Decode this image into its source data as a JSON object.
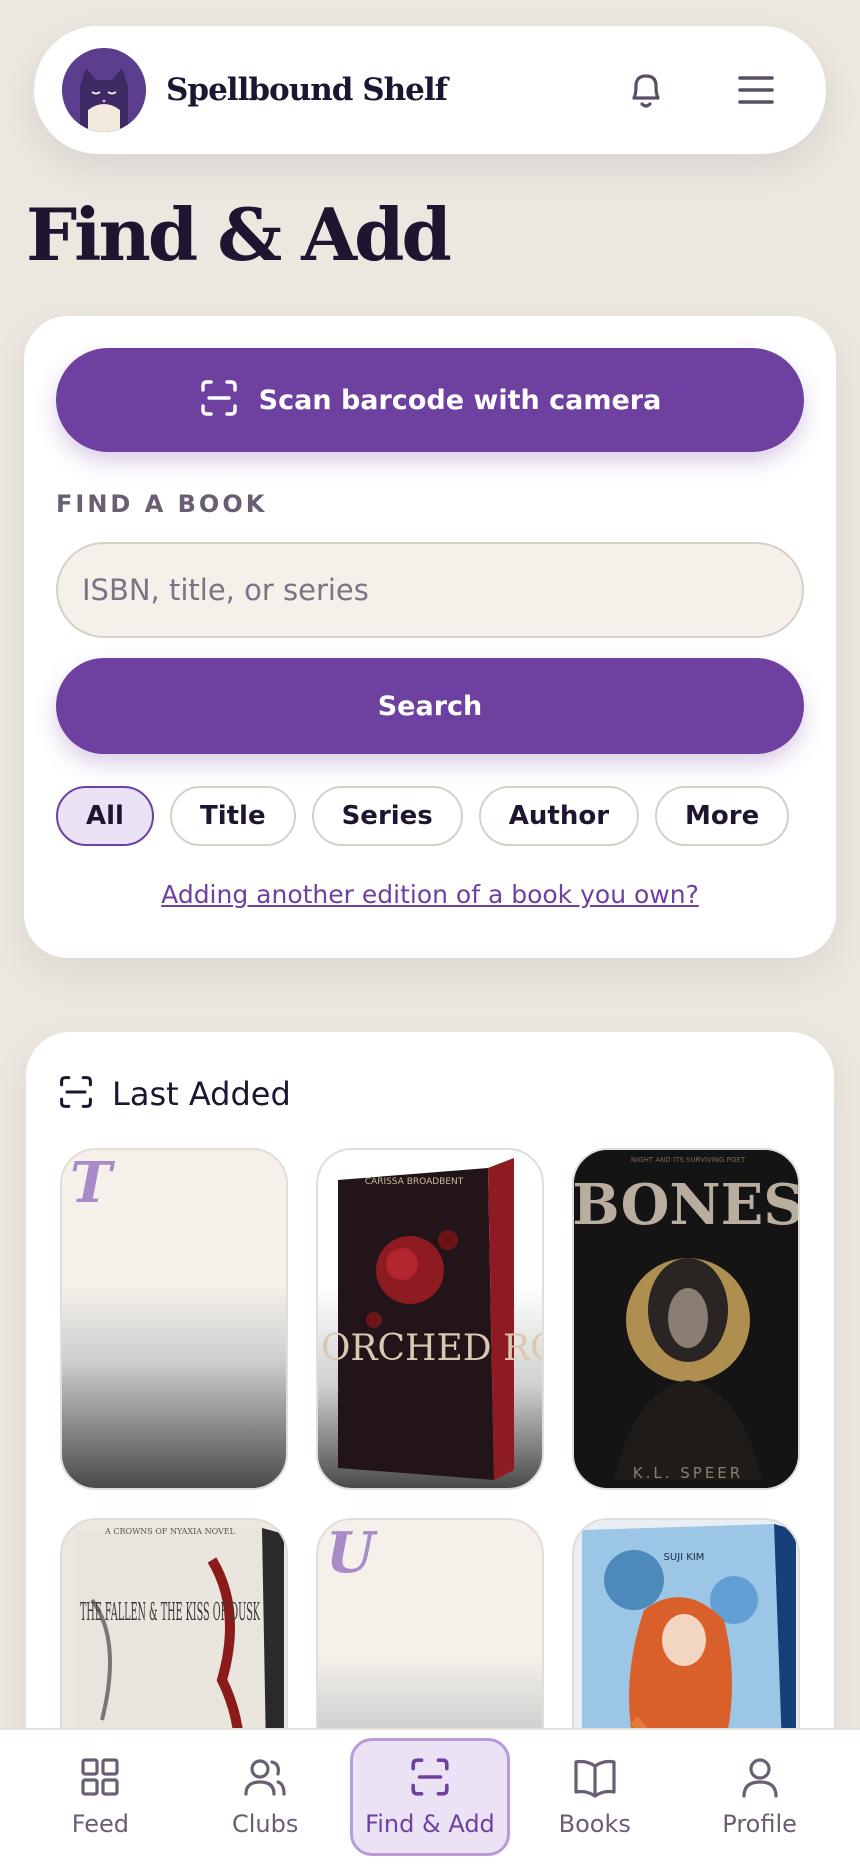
{
  "header": {
    "brand": "Spellbound Shelf",
    "icons": {
      "logo": "cat-logo",
      "bell": "bell-icon",
      "menu": "menu-icon"
    }
  },
  "page_title": "Find & Add",
  "find": {
    "scan_label": "Scan barcode with camera",
    "section_label": "FIND A BOOK",
    "search_placeholder": "ISBN, title, or series",
    "search_value": "",
    "search_button": "Search",
    "filters": [
      {
        "label": "All",
        "active": true
      },
      {
        "label": "Title",
        "active": false
      },
      {
        "label": "Series",
        "active": false
      },
      {
        "label": "Author",
        "active": false
      },
      {
        "label": "More",
        "active": false
      }
    ],
    "edition_link": "Adding another edition of a book you own?"
  },
  "last_added": {
    "title": "Last Added",
    "books": [
      {
        "kind": "placeholder",
        "initial": "T"
      },
      {
        "kind": "cover",
        "cover_title": "SIX SCORCHED ROSES",
        "author": "CARISSA BROADBENT",
        "colors": [
          "#2a1a20",
          "#8e1b22"
        ]
      },
      {
        "kind": "cover",
        "cover_title": "BONES",
        "top_line": "NIGHT AND ITS SURVIVING POET",
        "author": "K.L. SPEER",
        "colors": [
          "#141414",
          "#c9a45a"
        ]
      },
      {
        "kind": "cover",
        "cover_title": "THE FALLEN & THE KISS OF DUSK",
        "top_line": "A CROWNS OF NYAXIA NOVEL",
        "colors": [
          "#e9e4dc",
          "#8b1a1a"
        ]
      },
      {
        "kind": "placeholder",
        "initial": "U"
      },
      {
        "kind": "cover",
        "author": "SUJI KIM",
        "colors": [
          "#2d6fa8",
          "#d9602a"
        ]
      }
    ]
  },
  "nav": {
    "items": [
      {
        "label": "Feed",
        "icon": "grid-icon",
        "active": false
      },
      {
        "label": "Clubs",
        "icon": "users-icon",
        "active": false
      },
      {
        "label": "Find & Add",
        "icon": "scan-icon",
        "active": true
      },
      {
        "label": "Books",
        "icon": "book-open-icon",
        "active": false
      },
      {
        "label": "Profile",
        "icon": "user-icon",
        "active": false
      }
    ]
  },
  "colors": {
    "accent": "#6e41a1",
    "background": "#ece7df",
    "card": "#ffffff"
  }
}
